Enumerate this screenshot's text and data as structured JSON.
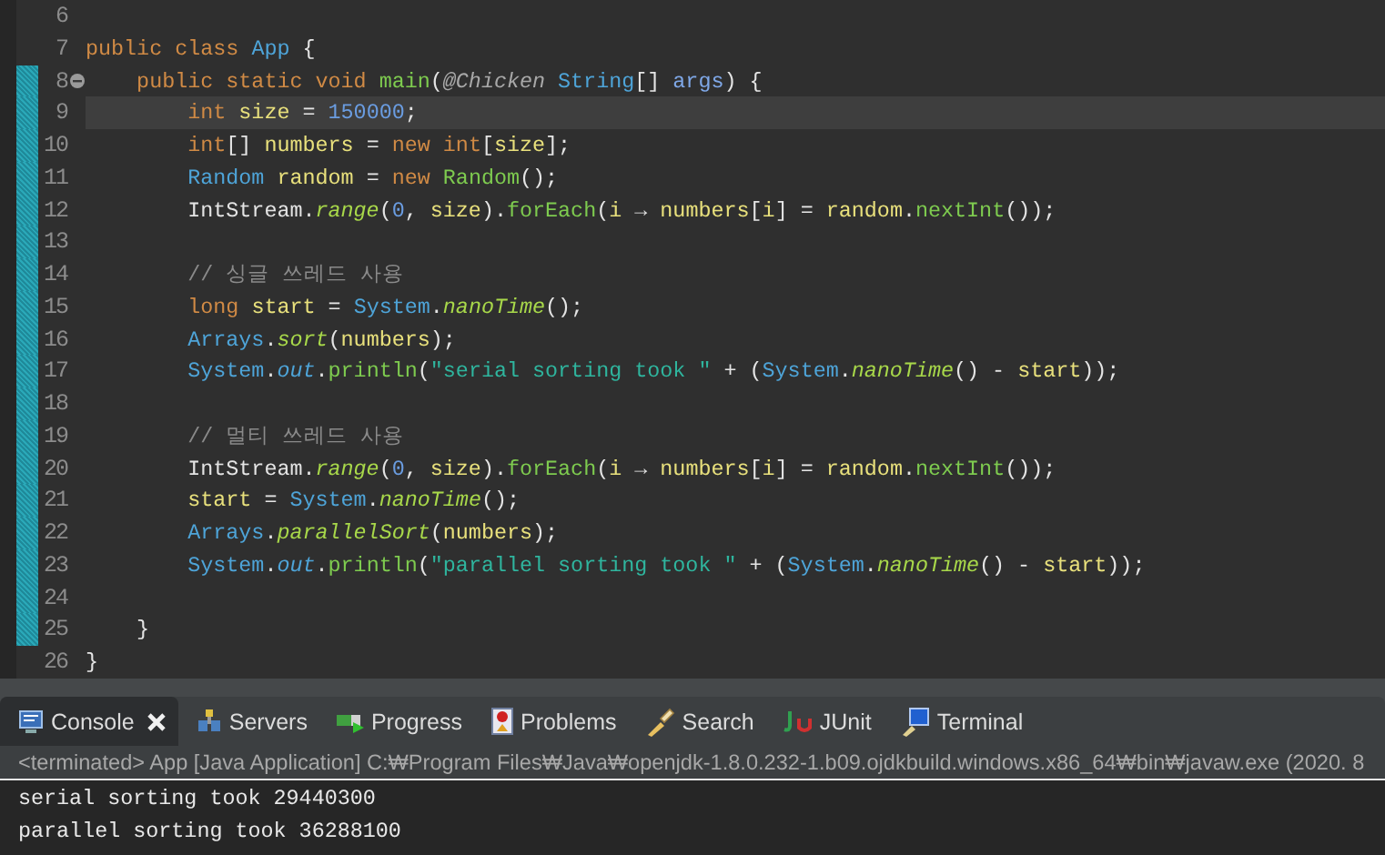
{
  "editor": {
    "lines": [
      {
        "number": "6",
        "changed": false,
        "current": false
      },
      {
        "number": "7",
        "changed": false,
        "current": false,
        "tokens": [
          {
            "kind": "kw",
            "text": "public class "
          },
          {
            "kind": "type",
            "text": "App"
          },
          {
            "kind": "plain",
            "text": " {"
          }
        ]
      },
      {
        "number": "8",
        "changed": true,
        "current": false,
        "fold": true,
        "tokens": [
          {
            "kind": "kw",
            "text": "    public static void "
          },
          {
            "kind": "method",
            "text": "main"
          },
          {
            "kind": "plain",
            "text": "("
          },
          {
            "kind": "anno",
            "text": "@Chicken "
          },
          {
            "kind": "type",
            "text": "String"
          },
          {
            "kind": "plain",
            "text": "[] "
          },
          {
            "kind": "param",
            "text": "args"
          },
          {
            "kind": "plain",
            "text": ") {"
          }
        ]
      },
      {
        "number": "9",
        "changed": true,
        "current": true,
        "tokens": [
          {
            "kind": "kw",
            "text": "        int "
          },
          {
            "kind": "var",
            "text": "size"
          },
          {
            "kind": "plain",
            "text": " = "
          },
          {
            "kind": "num",
            "text": "150000"
          },
          {
            "kind": "plain",
            "text": ";"
          }
        ]
      },
      {
        "number": "10",
        "changed": true,
        "current": false,
        "tokens": [
          {
            "kind": "kw",
            "text": "        int"
          },
          {
            "kind": "plain",
            "text": "[] "
          },
          {
            "kind": "var",
            "text": "numbers"
          },
          {
            "kind": "plain",
            "text": " = "
          },
          {
            "kind": "kw",
            "text": "new int"
          },
          {
            "kind": "plain",
            "text": "["
          },
          {
            "kind": "var",
            "text": "size"
          },
          {
            "kind": "plain",
            "text": "];"
          }
        ]
      },
      {
        "number": "11",
        "changed": true,
        "current": false,
        "tokens": [
          {
            "kind": "type",
            "text": "        Random "
          },
          {
            "kind": "var",
            "text": "random"
          },
          {
            "kind": "plain",
            "text": " = "
          },
          {
            "kind": "kw",
            "text": "new "
          },
          {
            "kind": "method",
            "text": "Random"
          },
          {
            "kind": "plain",
            "text": "();"
          }
        ]
      },
      {
        "number": "12",
        "changed": true,
        "current": false,
        "tokens": [
          {
            "kind": "plain",
            "text": "        IntStream."
          },
          {
            "kind": "smethod",
            "text": "range"
          },
          {
            "kind": "plain",
            "text": "("
          },
          {
            "kind": "num",
            "text": "0"
          },
          {
            "kind": "plain",
            "text": ", "
          },
          {
            "kind": "var",
            "text": "size"
          },
          {
            "kind": "plain",
            "text": ")."
          },
          {
            "kind": "method",
            "text": "forEach"
          },
          {
            "kind": "plain",
            "text": "("
          },
          {
            "kind": "var",
            "text": "i"
          },
          {
            "kind": "plain",
            "text": " → "
          },
          {
            "kind": "var",
            "text": "numbers"
          },
          {
            "kind": "plain",
            "text": "["
          },
          {
            "kind": "var",
            "text": "i"
          },
          {
            "kind": "plain",
            "text": "] = "
          },
          {
            "kind": "var",
            "text": "random"
          },
          {
            "kind": "plain",
            "text": "."
          },
          {
            "kind": "method",
            "text": "nextInt"
          },
          {
            "kind": "plain",
            "text": "());"
          }
        ]
      },
      {
        "number": "13",
        "changed": true,
        "current": false
      },
      {
        "number": "14",
        "changed": true,
        "current": false,
        "tokens": [
          {
            "kind": "comment",
            "text": "        // 싱글 쓰레드 사용"
          }
        ]
      },
      {
        "number": "15",
        "changed": true,
        "current": false,
        "tokens": [
          {
            "kind": "kw",
            "text": "        long "
          },
          {
            "kind": "var",
            "text": "start"
          },
          {
            "kind": "plain",
            "text": " = "
          },
          {
            "kind": "type",
            "text": "System"
          },
          {
            "kind": "plain",
            "text": "."
          },
          {
            "kind": "smethod",
            "text": "nanoTime"
          },
          {
            "kind": "plain",
            "text": "();"
          }
        ]
      },
      {
        "number": "16",
        "changed": true,
        "current": false,
        "tokens": [
          {
            "kind": "type",
            "text": "        Arrays"
          },
          {
            "kind": "plain",
            "text": "."
          },
          {
            "kind": "smethod",
            "text": "sort"
          },
          {
            "kind": "plain",
            "text": "("
          },
          {
            "kind": "var",
            "text": "numbers"
          },
          {
            "kind": "plain",
            "text": ");"
          }
        ]
      },
      {
        "number": "17",
        "changed": true,
        "current": false,
        "tokens": [
          {
            "kind": "type",
            "text": "        System"
          },
          {
            "kind": "plain",
            "text": "."
          },
          {
            "kind": "field",
            "text": "out"
          },
          {
            "kind": "plain",
            "text": "."
          },
          {
            "kind": "method",
            "text": "println"
          },
          {
            "kind": "plain",
            "text": "("
          },
          {
            "kind": "str",
            "text": "\"serial sorting took \""
          },
          {
            "kind": "plain",
            "text": " + ("
          },
          {
            "kind": "type",
            "text": "System"
          },
          {
            "kind": "plain",
            "text": "."
          },
          {
            "kind": "smethod",
            "text": "nanoTime"
          },
          {
            "kind": "plain",
            "text": "() - "
          },
          {
            "kind": "var",
            "text": "start"
          },
          {
            "kind": "plain",
            "text": "));"
          }
        ]
      },
      {
        "number": "18",
        "changed": true,
        "current": false
      },
      {
        "number": "19",
        "changed": true,
        "current": false,
        "tokens": [
          {
            "kind": "comment",
            "text": "        // 멀티 쓰레드 사용"
          }
        ]
      },
      {
        "number": "20",
        "changed": true,
        "current": false,
        "tokens": [
          {
            "kind": "plain",
            "text": "        IntStream."
          },
          {
            "kind": "smethod",
            "text": "range"
          },
          {
            "kind": "plain",
            "text": "("
          },
          {
            "kind": "num",
            "text": "0"
          },
          {
            "kind": "plain",
            "text": ", "
          },
          {
            "kind": "var",
            "text": "size"
          },
          {
            "kind": "plain",
            "text": ")."
          },
          {
            "kind": "method",
            "text": "forEach"
          },
          {
            "kind": "plain",
            "text": "("
          },
          {
            "kind": "var",
            "text": "i"
          },
          {
            "kind": "plain",
            "text": " → "
          },
          {
            "kind": "var",
            "text": "numbers"
          },
          {
            "kind": "plain",
            "text": "["
          },
          {
            "kind": "var",
            "text": "i"
          },
          {
            "kind": "plain",
            "text": "] = "
          },
          {
            "kind": "var",
            "text": "random"
          },
          {
            "kind": "plain",
            "text": "."
          },
          {
            "kind": "method",
            "text": "nextInt"
          },
          {
            "kind": "plain",
            "text": "());"
          }
        ]
      },
      {
        "number": "21",
        "changed": true,
        "current": false,
        "tokens": [
          {
            "kind": "var",
            "text": "        start"
          },
          {
            "kind": "plain",
            "text": " = "
          },
          {
            "kind": "type",
            "text": "System"
          },
          {
            "kind": "plain",
            "text": "."
          },
          {
            "kind": "smethod",
            "text": "nanoTime"
          },
          {
            "kind": "plain",
            "text": "();"
          }
        ]
      },
      {
        "number": "22",
        "changed": true,
        "current": false,
        "tokens": [
          {
            "kind": "type",
            "text": "        Arrays"
          },
          {
            "kind": "plain",
            "text": "."
          },
          {
            "kind": "smethod",
            "text": "parallelSort"
          },
          {
            "kind": "plain",
            "text": "("
          },
          {
            "kind": "var",
            "text": "numbers"
          },
          {
            "kind": "plain",
            "text": ");"
          }
        ]
      },
      {
        "number": "23",
        "changed": true,
        "current": false,
        "tokens": [
          {
            "kind": "type",
            "text": "        System"
          },
          {
            "kind": "plain",
            "text": "."
          },
          {
            "kind": "field",
            "text": "out"
          },
          {
            "kind": "plain",
            "text": "."
          },
          {
            "kind": "method",
            "text": "println"
          },
          {
            "kind": "plain",
            "text": "("
          },
          {
            "kind": "str",
            "text": "\"parallel sorting took \""
          },
          {
            "kind": "plain",
            "text": " + ("
          },
          {
            "kind": "type",
            "text": "System"
          },
          {
            "kind": "plain",
            "text": "."
          },
          {
            "kind": "smethod",
            "text": "nanoTime"
          },
          {
            "kind": "plain",
            "text": "() - "
          },
          {
            "kind": "var",
            "text": "start"
          },
          {
            "kind": "plain",
            "text": "));"
          }
        ]
      },
      {
        "number": "24",
        "changed": true,
        "current": false
      },
      {
        "number": "25",
        "changed": true,
        "current": false,
        "tokens": [
          {
            "kind": "plain",
            "text": "    }"
          }
        ]
      },
      {
        "number": "26",
        "changed": false,
        "current": false,
        "tokens": [
          {
            "kind": "plain",
            "text": "}"
          }
        ]
      }
    ]
  },
  "console": {
    "tabs": [
      {
        "kind": "console",
        "label": "Console",
        "selected": true
      },
      {
        "kind": "servers",
        "label": "Servers",
        "selected": false
      },
      {
        "kind": "progress",
        "label": "Progress",
        "selected": false
      },
      {
        "kind": "problems",
        "label": "Problems",
        "selected": false
      },
      {
        "kind": "search",
        "label": "Search",
        "selected": false
      },
      {
        "kind": "junit",
        "label": "JUnit",
        "selected": false
      },
      {
        "kind": "terminal",
        "label": "Terminal",
        "selected": false
      }
    ],
    "status": "<terminated> App [Java Application] C:₩Program Files₩Java₩openjdk-1.8.0.232-1.b09.ojdkbuild.windows.x86_64₩bin₩javaw.exe (2020. 8",
    "output": [
      "serial sorting took 29440300",
      "parallel sorting took 36288100"
    ]
  }
}
